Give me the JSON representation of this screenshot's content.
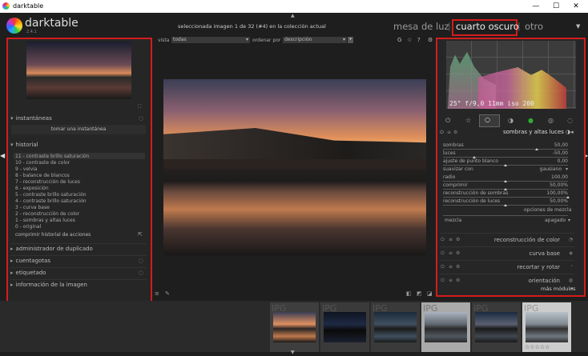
{
  "window": {
    "title": "darktable",
    "min": "—",
    "max": "☐",
    "close": "✕"
  },
  "app": {
    "name": "darktable",
    "version": "2.4.1"
  },
  "header": {
    "info": "seleccionada imagen 1 de 32 (#4) en la colección actual",
    "views": [
      "mesa de luz",
      "cuarto oscuro",
      "otro"
    ],
    "sep": "|",
    "active_view": "cuarto oscuro"
  },
  "left": {
    "snapshots_title": "instantáneas",
    "snapshot_button": "tomar una instantánea",
    "history_title": "historial",
    "history": [
      "11 - contraste brillo saturación",
      "10 - contraste de color",
      "9 - velvia",
      "8 - balance de blancos",
      "7 - reconstrucción de luces",
      "6 - exposición",
      "5 - contraste brillo saturación",
      "4 - contraste brillo saturación",
      "3 - curva base",
      "2 - reconstrucción de color",
      "1 - sombras y altas luces",
      "0 - original"
    ],
    "compress": "comprimir historial de acciones",
    "modules": [
      "administrador de duplicado",
      "cuentagotas",
      "etiquetado",
      "información de la imagen"
    ]
  },
  "toolbar": {
    "view_label": "vista",
    "view_value": "todas",
    "sort_label": "ordenar por",
    "sort_value": "descripción"
  },
  "right": {
    "exif": "25\" f/9,0 11mm iso 200",
    "module_title": "sombras y altas luces",
    "sliders": [
      {
        "label": "sombras",
        "value": "50,00",
        "pos": 0.75
      },
      {
        "label": "luces",
        "value": "-50,00",
        "pos": 0.25
      },
      {
        "label": "ajuste de punto blanco",
        "value": "0,00",
        "pos": 0.5
      },
      {
        "label": "suavizar con",
        "value": "gausiano",
        "pos": null
      },
      {
        "label": "radio",
        "value": "100,00",
        "pos": 0.5
      },
      {
        "label": "comprimir",
        "value": "50,00%",
        "pos": 0.5
      },
      {
        "label": "reconstrucción de sombras",
        "value": "100,00%",
        "pos": 1
      },
      {
        "label": "reconstrucción de luces",
        "value": "50,00%",
        "pos": 0.5
      }
    ],
    "blend_link": "opciones de mezcla",
    "blend_label": "mezcla",
    "blend_value": "apagado",
    "modules": [
      "reconstrucción de color",
      "curva base",
      "recortar y rotar",
      "orientación"
    ],
    "more": "más módulos"
  },
  "filmstrip": {
    "labels": [
      "IPG",
      "IPG",
      "IPG",
      "IPG",
      "IPG",
      "IPG"
    ],
    "stars": "☆☆☆☆☆"
  },
  "colors": {
    "highlight": "#d41c1c",
    "panel": "#262626",
    "bg": "#1e1e1e"
  }
}
